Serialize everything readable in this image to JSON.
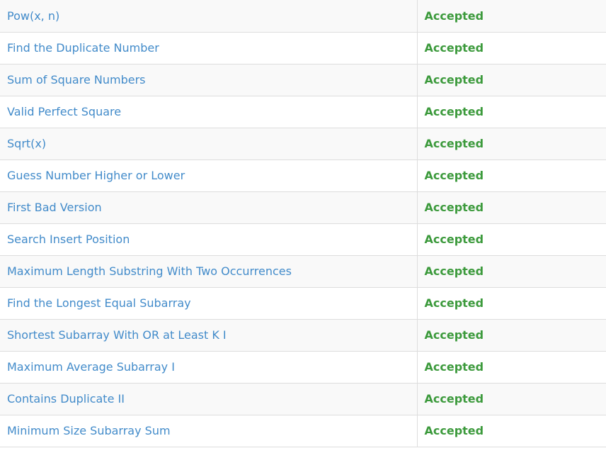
{
  "colors": {
    "link": "#428bca",
    "accepted": "#3c9a3c",
    "row_alt": "#f9f9f9",
    "border": "#dddddd"
  },
  "rows": [
    {
      "title": "Pow(x, n)",
      "status": "Accepted"
    },
    {
      "title": "Find the Duplicate Number",
      "status": "Accepted"
    },
    {
      "title": "Sum of Square Numbers",
      "status": "Accepted"
    },
    {
      "title": "Valid Perfect Square",
      "status": "Accepted"
    },
    {
      "title": "Sqrt(x)",
      "status": "Accepted"
    },
    {
      "title": "Guess Number Higher or Lower",
      "status": "Accepted"
    },
    {
      "title": "First Bad Version",
      "status": "Accepted"
    },
    {
      "title": "Search Insert Position",
      "status": "Accepted"
    },
    {
      "title": "Maximum Length Substring With Two Occurrences",
      "status": "Accepted"
    },
    {
      "title": "Find the Longest Equal Subarray",
      "status": "Accepted"
    },
    {
      "title": "Shortest Subarray With OR at Least K I",
      "status": "Accepted"
    },
    {
      "title": "Maximum Average Subarray I",
      "status": "Accepted"
    },
    {
      "title": "Contains Duplicate II",
      "status": "Accepted"
    },
    {
      "title": "Minimum Size Subarray Sum",
      "status": "Accepted"
    }
  ]
}
